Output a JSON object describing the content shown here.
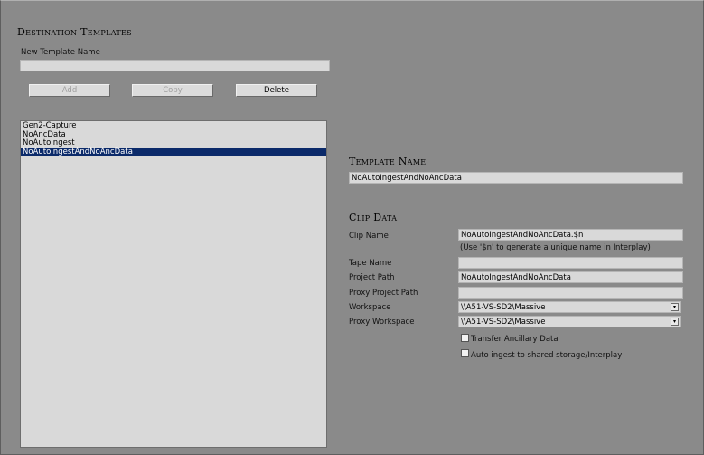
{
  "left_panel": {
    "title": "Destination Templates",
    "new_template_label": "New Template Name",
    "new_template_value": "",
    "buttons": {
      "add": "Add",
      "copy": "Copy",
      "delete": "Delete"
    },
    "templates": [
      "Gen2-Capture",
      "NoAncData",
      "NoAutoIngest",
      "NoAutoIngestAndNoAncData"
    ],
    "selected_template": "NoAutoIngestAndNoAncData"
  },
  "right_panel": {
    "template_name_title": "Template Name",
    "template_name_value": "NoAutoIngestAndNoAncData",
    "clip_data_title": "Clip Data",
    "clip_name_label": "Clip Name",
    "clip_name_value": "NoAutoIngestAndNoAncData.$n",
    "clip_name_hint": "(Use '$n' to generate a unique name in Interplay)",
    "tape_name_label": "Tape Name",
    "tape_name_value": "",
    "project_path_label": "Project Path",
    "project_path_value": "NoAutoIngestAndNoAncData",
    "proxy_project_path_label": "Proxy Project Path",
    "proxy_project_path_value": "",
    "workspace_label": "Workspace",
    "workspace_value": "\\\\A51-VS-SD2\\Massive",
    "proxy_workspace_label": "Proxy Workspace",
    "proxy_workspace_value": "\\\\A51-VS-SD2\\Massive",
    "transfer_ancillary_label": "Transfer Ancillary Data",
    "transfer_ancillary_checked": false,
    "auto_ingest_label": "Auto ingest to shared storage/Interplay",
    "auto_ingest_checked": false
  },
  "colors": {
    "background": "#8a8a8a",
    "field": "#d9d9d9",
    "selection": "#0b2a6a"
  }
}
